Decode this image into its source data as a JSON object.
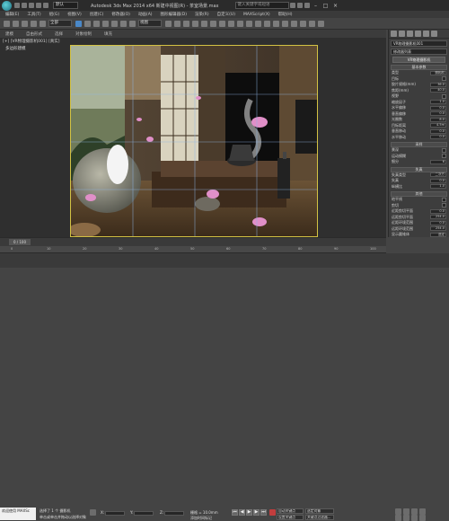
{
  "titlebar": {
    "workspace": "默认",
    "title": "Autodesk 3ds Max 2014 x64    新建中视图(R) - 茶室场景.max",
    "search_placeholder": "键入关键字或短语"
  },
  "menu": [
    "编辑(E)",
    "工具(T)",
    "组(G)",
    "视图(V)",
    "创建(C)",
    "修改器(O)",
    "动画(A)",
    "图形编辑器(D)",
    "渲染(R)",
    "自定义(U)",
    "MAXScript(X)",
    "帮助(H)"
  ],
  "toolbar": {
    "selection_filter": "全部",
    "ref_coord": "视图"
  },
  "ribbon": {
    "tabs": [
      "建模",
      "自由形式",
      "选择",
      "对象绘制",
      "填充"
    ]
  },
  "viewport": {
    "label": "[+] [VR物理摄影机001] [真实]",
    "subtab": "多边形建模"
  },
  "cmd_panel": {
    "object_name": "VR物理摄影机001",
    "modifier_list": "修改器列表",
    "stack_item": "VR物理摄影机",
    "params_title": "基本参数",
    "rows": [
      {
        "label": "类型",
        "value": "照相机"
      },
      {
        "label": "目标",
        "value": ""
      },
      {
        "label": "胶片规格(mm)",
        "value": "36.0"
      },
      {
        "label": "焦距(mm)",
        "value": "40.0"
      },
      {
        "label": "视野",
        "value": ""
      },
      {
        "label": "缩放因子",
        "value": "1.0"
      },
      {
        "label": "水平偏移",
        "value": "0.0"
      },
      {
        "label": "垂直偏移",
        "value": "0.0"
      },
      {
        "label": "光圈数",
        "value": "8.0"
      },
      {
        "label": "目标距离",
        "value": "4.5m"
      },
      {
        "label": "垂直移动",
        "value": "0.0"
      },
      {
        "label": "水平移动",
        "value": "0.0"
      }
    ],
    "section2_title": "采样",
    "rows2": [
      {
        "label": "景深",
        "value": ""
      },
      {
        "label": "运动模糊",
        "value": ""
      },
      {
        "label": "细分",
        "value": "6"
      }
    ],
    "section3_title": "失真",
    "rows3": [
      {
        "label": "失真类型",
        "value": "二次方"
      },
      {
        "label": "失真",
        "value": "0.0"
      },
      {
        "label": "纵横比",
        "value": "1.0"
      }
    ],
    "misc_title": "其他",
    "rows4": [
      {
        "label": "地平线",
        "value": ""
      },
      {
        "label": "剪切",
        "value": ""
      },
      {
        "label": "近距剪切平面",
        "value": "0.0"
      },
      {
        "label": "远距剪切平面",
        "value": "254.0"
      },
      {
        "label": "近距环境范围",
        "value": "0.0"
      },
      {
        "label": "远距环境范围",
        "value": "254.0"
      },
      {
        "label": "显示圆锥体",
        "value": "选定"
      }
    ]
  },
  "timeline": {
    "frame": "0 / 100"
  },
  "ruler": {
    "ticks": [
      "0",
      "10",
      "20",
      "30",
      "40",
      "50",
      "60",
      "70",
      "80",
      "90",
      "100"
    ]
  },
  "status": {
    "maxscript": "欢迎使用 MAXSc",
    "selected": "选择了 1 个 摄影机",
    "prompt": "单击或单击并拖动以选择对象",
    "x_label": "X:",
    "y_label": "Y:",
    "z_label": "Z:",
    "grid": "栅格 = 10.0mm",
    "auto_key": "自动关键点",
    "set_key": "设置关键点",
    "selected_obj": "选定对象",
    "key_filter": "关键点过滤器...",
    "add_time_tag": "添加时间标记"
  }
}
